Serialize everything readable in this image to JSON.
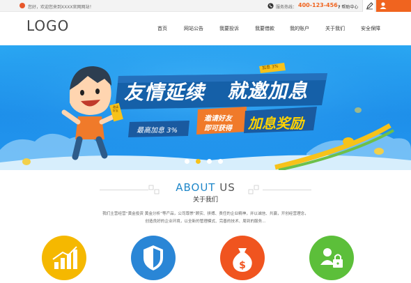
{
  "topbar": {
    "welcome": "您好，欢迎您来到XXXX官网网站！",
    "phone_label": "服务热线：",
    "phone_number": "400-123-456",
    "help": "帮助中心"
  },
  "header": {
    "logo": "LOGO",
    "nav": [
      "首页",
      "网站公告",
      "我要投诉",
      "我要借款",
      "我的账户",
      "关于我们",
      "安全保障"
    ]
  },
  "banner": {
    "headline_1": "友情延续",
    "headline_2": "就邀加息",
    "badge_top": "加息 3%",
    "ribbon_line1": "邀请好友",
    "ribbon_line2": "即可获得",
    "reward": "加息奖励",
    "max_rate": "最高加息 3%",
    "hand_tag": "邀请好友",
    "slides": 4,
    "active_slide": 2
  },
  "about": {
    "title_a": "ABOUT",
    "title_b": "US",
    "subtitle": "关于我们",
    "text_line1": "我们主营经营“黄金投资 黄金分析”等产品，公司尊崇“顾实、拼搏、责任的企业精神，并以诚信、共赢，开创经营理念，",
    "text_line2": "创造良好的企业环境，以全新的管理模式、完善的技术、周到的服务..."
  },
  "features": [
    {
      "icon": "growth-chart-icon",
      "color": "#f5b800"
    },
    {
      "icon": "shield-icon",
      "color": "#2a86d6"
    },
    {
      "icon": "money-bag-icon",
      "color": "#f0541f"
    },
    {
      "icon": "user-lock-icon",
      "color": "#5cbf3a"
    }
  ]
}
